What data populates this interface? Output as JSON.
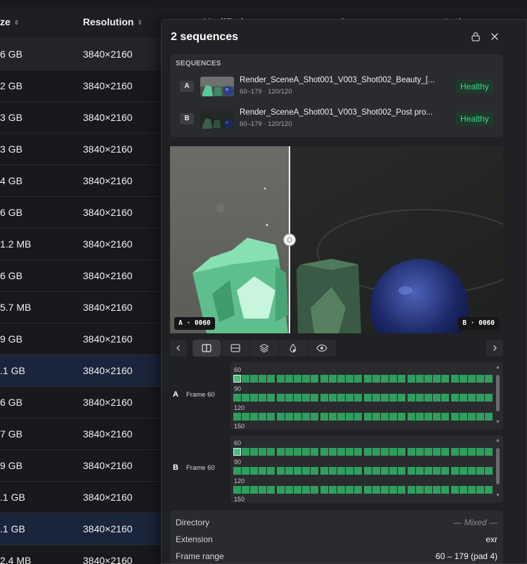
{
  "table": {
    "headers": {
      "size": "ze",
      "resolution": "Resolution",
      "modified": "Modified",
      "status": "Status",
      "actions": "Actions"
    },
    "rows": [
      {
        "size": "6 GB",
        "resolution": "3840×2160",
        "state": "hover"
      },
      {
        "size": "2 GB",
        "resolution": "3840×2160",
        "state": ""
      },
      {
        "size": "3 GB",
        "resolution": "3840×2160",
        "state": ""
      },
      {
        "size": "3 GB",
        "resolution": "3840×2160",
        "state": ""
      },
      {
        "size": "4 GB",
        "resolution": "3840×2160",
        "state": ""
      },
      {
        "size": "6 GB",
        "resolution": "3840×2160",
        "state": ""
      },
      {
        "size": "1.2 MB",
        "resolution": "3840×2160",
        "state": ""
      },
      {
        "size": "6 GB",
        "resolution": "3840×2160",
        "state": ""
      },
      {
        "size": "5.7 MB",
        "resolution": "3840×2160",
        "state": ""
      },
      {
        "size": "9 GB",
        "resolution": "3840×2160",
        "state": ""
      },
      {
        "size": ".1 GB",
        "resolution": "3840×2160",
        "state": "selected"
      },
      {
        "size": "6 GB",
        "resolution": "3840×2160",
        "state": ""
      },
      {
        "size": "7 GB",
        "resolution": "3840×2160",
        "state": ""
      },
      {
        "size": "9 GB",
        "resolution": "3840×2160",
        "state": ""
      },
      {
        "size": ".1 GB",
        "resolution": "3840×2160",
        "state": ""
      },
      {
        "size": ".1 GB",
        "resolution": "3840×2160",
        "state": "selected"
      },
      {
        "size": "2.4 MB",
        "resolution": "3840×2160",
        "state": ""
      }
    ]
  },
  "panel": {
    "title": "2 sequences",
    "icons": {
      "lock": "lock-icon",
      "close": "close-icon"
    },
    "sequences_header": "SEQUENCES",
    "sequences": [
      {
        "tag": "A",
        "name": "Render_SceneA_Shot001_V003_Shot002_Beauty_[...",
        "meta": "60–179 · 120/120",
        "status": "Healthy"
      },
      {
        "tag": "B",
        "name": "Render_SceneA_Shot001_V003_Shot002_Post pro...",
        "meta": "60–179 · 120/120",
        "status": "Healthy"
      }
    ],
    "viewer": {
      "label_a": "A · 0060",
      "label_b": "B · 0060",
      "split_position": 0.36
    },
    "toolbar": {
      "prev": "chevron-left-icon",
      "modes": [
        "split-vertical-icon",
        "split-horizontal-icon",
        "layers-icon",
        "drop-icon",
        "eye-icon"
      ],
      "active_mode": "split-vertical-icon",
      "next": "chevron-right-icon"
    },
    "frames": [
      {
        "tag": "A",
        "label": "Frame 60",
        "row_labels": [
          "60",
          "90",
          "120",
          "150"
        ],
        "current": 60
      },
      {
        "tag": "B",
        "label": "Frame 60",
        "row_labels": [
          "60",
          "90",
          "120",
          "150"
        ],
        "current": 60
      }
    ],
    "details": [
      {
        "key": "Directory",
        "value": "— Mixed —",
        "muted": true
      },
      {
        "key": "Extension",
        "value": "exr",
        "muted": false
      },
      {
        "key": "Frame range",
        "value": "60 – 179 (pad 4)",
        "muted": false
      }
    ],
    "colors": {
      "accent_green": "#3fd68a",
      "frame_cell": "#2f9e5e",
      "selected_row": "#18253a"
    }
  }
}
